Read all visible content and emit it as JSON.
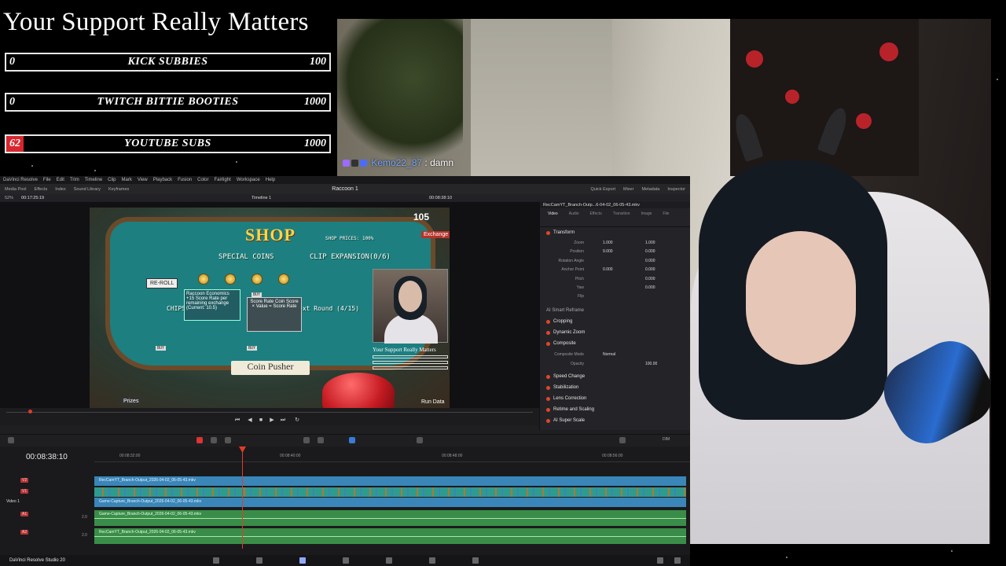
{
  "overlay": {
    "support_title": "Your Support Really Matters",
    "goals": [
      {
        "current": "0",
        "label": "KICK SUBBIES",
        "max": "100",
        "fill_fraction": 0
      },
      {
        "current": "0",
        "label": "TWITCH BITTIE BOOTIES",
        "max": "1000",
        "fill_fraction": 0
      },
      {
        "current": "62",
        "label": "YOUTUBE SUBS",
        "max": "1000",
        "fill_fraction": 0.062
      }
    ],
    "chat": {
      "user": "Kemo22_87",
      "message": ": damn"
    }
  },
  "resolve": {
    "app_name": "DaVinci Resolve",
    "menu": [
      "File",
      "Edit",
      "Trim",
      "Timeline",
      "Clip",
      "Mark",
      "View",
      "Playback",
      "Fusion",
      "Color",
      "Fairlight",
      "Workspace",
      "Help"
    ],
    "toolbar_left": [
      "Media Pool",
      "Effects",
      "Index",
      "Sound Library",
      "Keyframes"
    ],
    "project_name": "Raccoon 1",
    "toolbar_right": [
      "Quick Export",
      "Mixer",
      "Metadata",
      "Inspector"
    ],
    "viewer": {
      "zoom": "52%",
      "source_timecode": "00:17:25:19",
      "timeline_name": "Timeline 1",
      "timecode": "00:08:38:10"
    },
    "game": {
      "shop_title": "SHOP",
      "shop_prices": "SHOP PRICES: 100%",
      "coin_count": "105",
      "exchange": "Exchange",
      "special_coins": "SPECIAL COINS",
      "clip_expansion": "CLIP EXPANSION(0/6)",
      "reroll": "RE-ROLL",
      "chips": "CHIPS",
      "next_round": "ext Round (4/15)",
      "tooltip_title": "Raccoon Economics",
      "tooltip_body": "+15 Score Rate per remaining exchange (Current: 10.5)",
      "tooltip2": "Score Rate Coin Score × Value = Score Rate",
      "pusher": "Coin Pusher",
      "prizes": "Prizes",
      "run_data": "Run Data",
      "mini_support": "Your Support Really Matters",
      "buy": "BUY"
    },
    "inspector": {
      "clip_name": "RecCamYT_Branch-Outp...6-04-02_06-05-43.mkv",
      "tabs": [
        "Video",
        "Audio",
        "Effects",
        "Transition",
        "Image",
        "File"
      ],
      "transform_label": "Transform",
      "rows": [
        {
          "key": "Zoom",
          "x": "1.000",
          "y": "1.000"
        },
        {
          "key": "Position",
          "x": "9.000",
          "y": "0.000"
        },
        {
          "key": "Rotation Angle",
          "x": "",
          "y": "0.000"
        },
        {
          "key": "Anchor Point",
          "x": "0.000",
          "y": "0.000"
        },
        {
          "key": "Pitch",
          "x": "",
          "y": "0.000"
        },
        {
          "key": "Yaw",
          "x": "",
          "y": "0.000"
        },
        {
          "key": "Flip",
          "x": "",
          "y": ""
        }
      ],
      "sections": [
        "AI Smart Reframe",
        "Cropping",
        "Dynamic Zoom",
        "Composite"
      ],
      "composite_mode_label": "Composite Mode",
      "composite_mode_value": "Normal",
      "opacity_label": "Opacity",
      "opacity_value": "100.00",
      "more_sections": [
        "Speed Change",
        "Stabilization",
        "Lens Correction",
        "Retime and Scaling",
        "AI Super Scale"
      ]
    },
    "timeline": {
      "timecode": "00:08:38:10",
      "ruler": [
        "00:08:32:00",
        "00:08:40:00",
        "00:08:48:00",
        "00:08:56:00"
      ],
      "volume_label": "DIM",
      "tracks": [
        {
          "id": "V2",
          "clip": "RecCamYT_Branch-Output_2026-04-02_06-05-43.mkv",
          "kind": "video"
        },
        {
          "id": "V1",
          "clip": "",
          "kind": "thumbs"
        },
        {
          "id": "Video 1",
          "clip": "Game-Capture_Branch-Output_2026-04-02_06-05-43.mkv",
          "kind": "video"
        },
        {
          "id": "A1",
          "clip": "Game-Capture_Branch-Output_2026-04-02_06-05-43.mkv",
          "kind": "audio",
          "level": "2.0"
        },
        {
          "id": "A2",
          "clip": "RecCamYT_Branch-Output_2026-04-02_06-05-43.mkv",
          "kind": "audio",
          "level": "2.0"
        }
      ]
    },
    "status": "DaVinci Resolve Studio 20"
  }
}
